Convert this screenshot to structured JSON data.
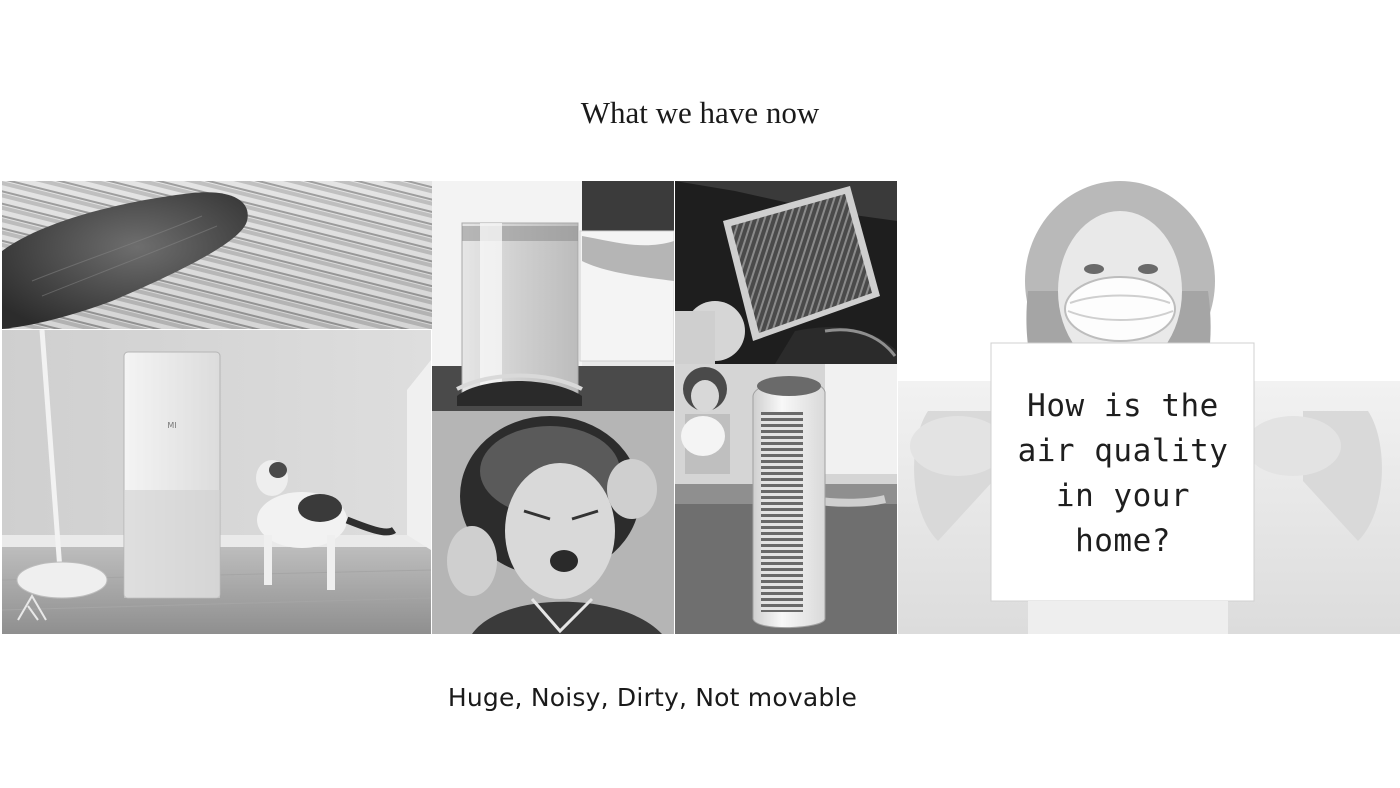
{
  "slide": {
    "title": "What we have now",
    "caption": "Huge, Noisy, Dirty, Not movable"
  },
  "photos": {
    "finger": {
      "icon": "dusty-finger-photo"
    },
    "mi_purifier": {
      "icon": "purifier-with-cat-photo"
    },
    "tower": {
      "icon": "tower-purifier-photo"
    },
    "woman": {
      "icon": "woman-covering-ears-photo"
    },
    "filter": {
      "icon": "dirty-filter-photo"
    },
    "column": {
      "icon": "column-purifier-photo"
    },
    "mask": {
      "icon": "woman-with-mask-photo",
      "sign_text": "How is the\nair quality\nin your\nhome?"
    }
  }
}
